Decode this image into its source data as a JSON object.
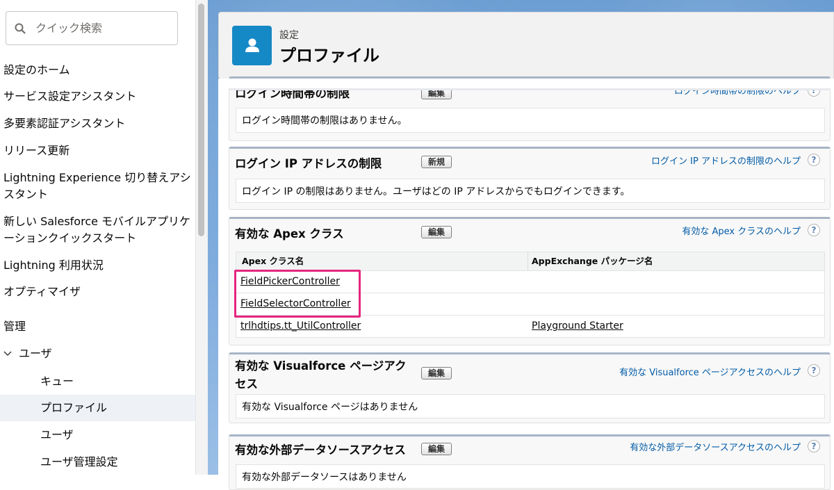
{
  "sidebar": {
    "search_placeholder": "クイック検索",
    "items": [
      {
        "label": "設定のホーム"
      },
      {
        "label": "サービス設定アシスタント"
      },
      {
        "label": "多要素認証アシスタント"
      },
      {
        "label": "リリース更新"
      },
      {
        "label": "Lightning Experience 切り替えアシスタント"
      },
      {
        "label": "新しい Salesforce モバイルアプリケーションクイックスタート"
      },
      {
        "label": "Lightning 利用状況"
      },
      {
        "label": "オプティマイザ"
      },
      {
        "label": "管理"
      },
      {
        "label": "ユーザ"
      },
      {
        "label": "キュー"
      },
      {
        "label": "プロファイル"
      },
      {
        "label": "ユーザ"
      },
      {
        "label": "ユーザ管理設定"
      }
    ]
  },
  "header": {
    "breadcrumb": "設定",
    "title": "プロファイル"
  },
  "sections": {
    "login_hours": {
      "title": "ログイン時間帯の制限",
      "button": "編集",
      "help": "ログイン時間帯の制限のヘルプ",
      "body": "ログイン時間帯の制限はありません。"
    },
    "login_ip": {
      "title": "ログイン IP アドレスの制限",
      "button": "新規",
      "help": "ログイン IP アドレスの制限のヘルプ",
      "body": "ログイン IP の制限はありません。ユーザはどの IP アドレスからでもログインできます。"
    },
    "apex": {
      "title": "有効な Apex クラス",
      "button": "編集",
      "help": "有効な Apex クラスのヘルプ",
      "columns": [
        "Apex クラス名",
        "AppExchange パッケージ名"
      ],
      "rows": [
        [
          "FieldPickerController",
          ""
        ],
        [
          "FieldSelectorController",
          ""
        ],
        [
          "trlhdtips.tt_UtilController",
          "Playground Starter"
        ]
      ]
    },
    "visualforce": {
      "title": "有効な Visualforce ページアクセス",
      "button": "編集",
      "help": "有効な Visualforce ページアクセスのヘルプ",
      "body": "有効な Visualforce ページはありません"
    },
    "external_data": {
      "title": "有効な外部データソースアクセス",
      "button": "編集",
      "help": "有効な外部データソースアクセスのヘルプ",
      "body": "有効な外部データソースはありません"
    }
  },
  "help_glyph": "?",
  "colors": {
    "link": "#015ba7",
    "header_icon": "#1589c5",
    "highlight": "#e5267d",
    "selected_bg": "#eef1f6"
  }
}
